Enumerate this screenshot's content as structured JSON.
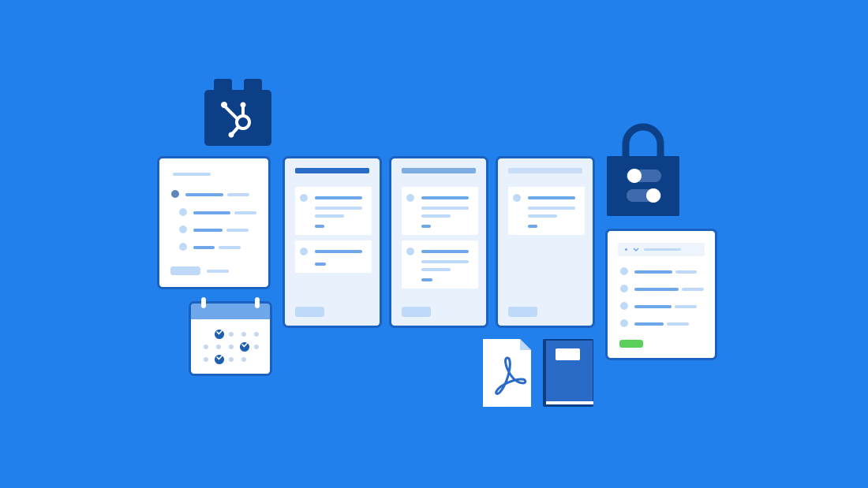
{
  "scene": {
    "background_color": "#2180EC",
    "accent_dark": "#0D3F87",
    "card_border": "#1A62C2",
    "success_color": "#5AD05A"
  },
  "icons": {
    "hub": "hubspot-sprocket-icon",
    "lock": "padlock-icon",
    "pdf": "pdf-document-icon",
    "book": "notebook-icon",
    "calendar": "calendar-icon"
  },
  "board": {
    "columns": [
      {
        "header_tone": "#2A6BC8",
        "cards": 2
      },
      {
        "header_tone": "#7EADE2",
        "cards": 2
      },
      {
        "header_tone": "#C9DEF6",
        "cards": 1
      }
    ]
  },
  "calendar": {
    "checked_days": 3
  }
}
